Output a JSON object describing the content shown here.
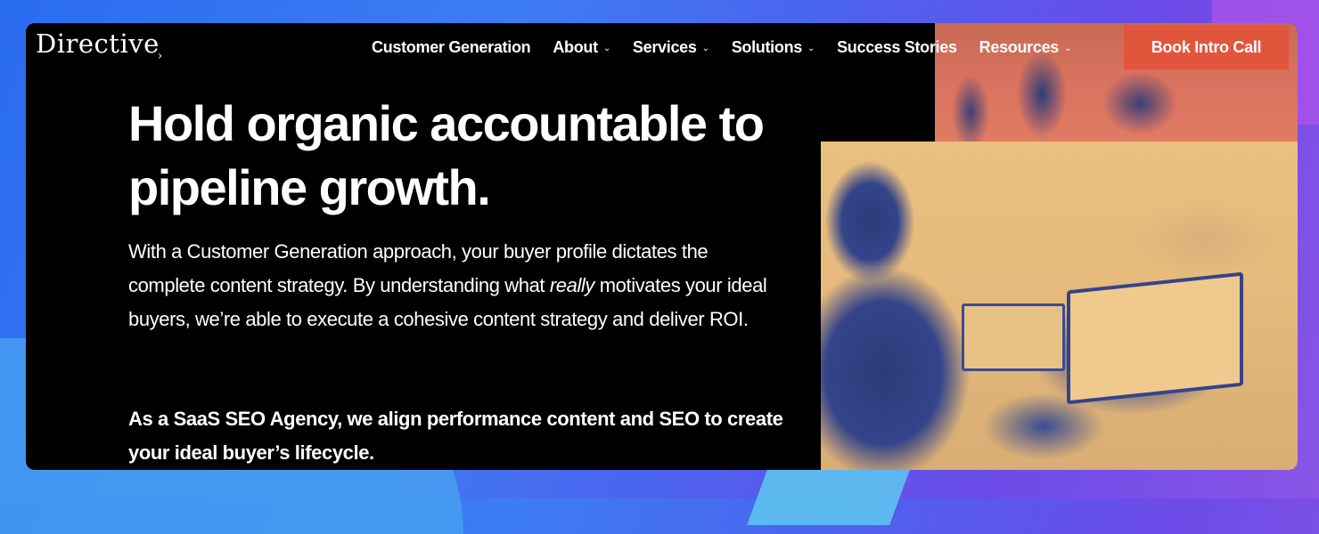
{
  "brand": {
    "logo_text": "Directive",
    "logo_mark": "›"
  },
  "nav": {
    "items": [
      {
        "label": "Customer Generation",
        "has_dropdown": false
      },
      {
        "label": "About",
        "has_dropdown": true
      },
      {
        "label": "Services",
        "has_dropdown": true
      },
      {
        "label": "Solutions",
        "has_dropdown": true
      },
      {
        "label": "Success Stories",
        "has_dropdown": false
      },
      {
        "label": "Resources",
        "has_dropdown": true
      }
    ],
    "dropdown_glyph": "⌄",
    "cta_label": "Book Intro Call"
  },
  "hero": {
    "headline": "Hold organic accountable to pipeline growth.",
    "body_before": "With a Customer Generation approach, your buyer profile dictates the complete content strategy. By understanding what ",
    "body_emphasis": "really",
    "body_after": " motivates your ideal buyers, we’re able to execute a cohesive content strategy and deliver ROI.",
    "body_bold": "As a SaaS SEO Agency, we align performance content and SEO to create your ideal buyer’s lifecycle."
  },
  "colors": {
    "card_bg": "#000000",
    "cta_bg": "#e2553d",
    "text": "#ffffff",
    "photo_tint_warm": "#e9c07f",
    "photo_tint_blue": "#34448a",
    "photo_tint_coral": "#dc7460"
  },
  "icons": {
    "dropdown": "chevron-down-icon",
    "logo_arrow": "arrow-icon"
  }
}
